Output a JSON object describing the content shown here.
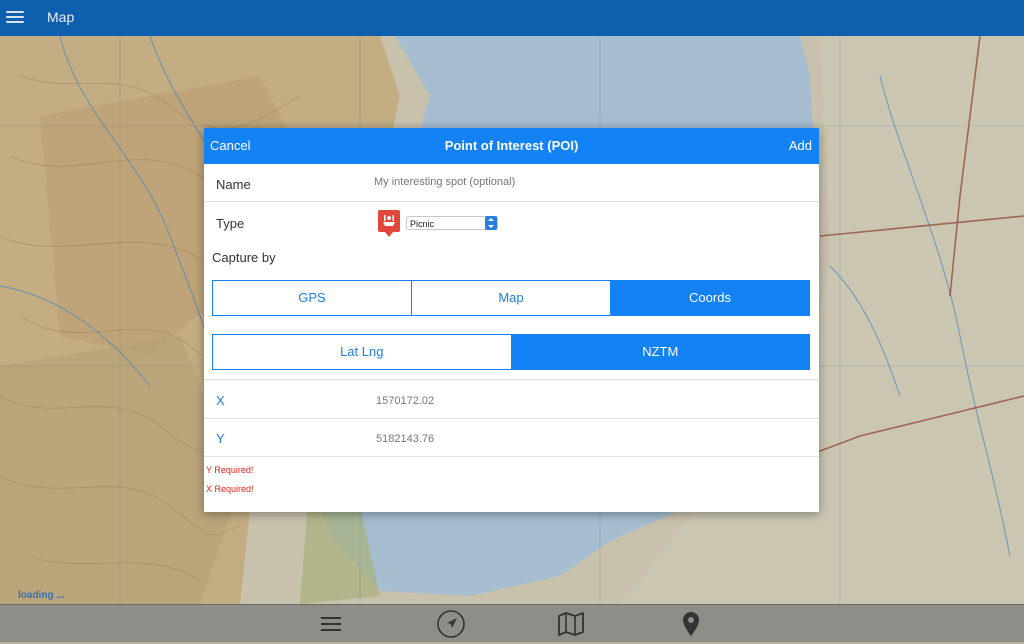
{
  "appbar": {
    "title": "Map"
  },
  "status": {
    "loading": "loading ..."
  },
  "dialog": {
    "cancel": "Cancel",
    "title": "Point of Interest (POI)",
    "add": "Add",
    "name_label": "Name",
    "name_placeholder": "My interesting spot (optional)",
    "name_value": "",
    "type_label": "Type",
    "type_value": "Picnic",
    "type_icon": "picnic-icon",
    "capture_label": "Capture by",
    "capture_options": [
      "GPS",
      "Map",
      "Coords"
    ],
    "capture_selected": "Coords",
    "coord_options": [
      "Lat Lng",
      "NZTM"
    ],
    "coord_selected": "NZTM",
    "x_label": "X",
    "x_value": "1570172.02",
    "y_label": "Y",
    "y_value": "5182143.76",
    "errors": [
      "Y Required!",
      "X Required!"
    ]
  },
  "bottom_bar": [
    "menu-icon",
    "navigation-arrow-icon",
    "map-icon",
    "location-pin-icon"
  ],
  "colors": {
    "header": "#0e5fad",
    "accent": "#1282f5",
    "error": "#e0261b"
  }
}
